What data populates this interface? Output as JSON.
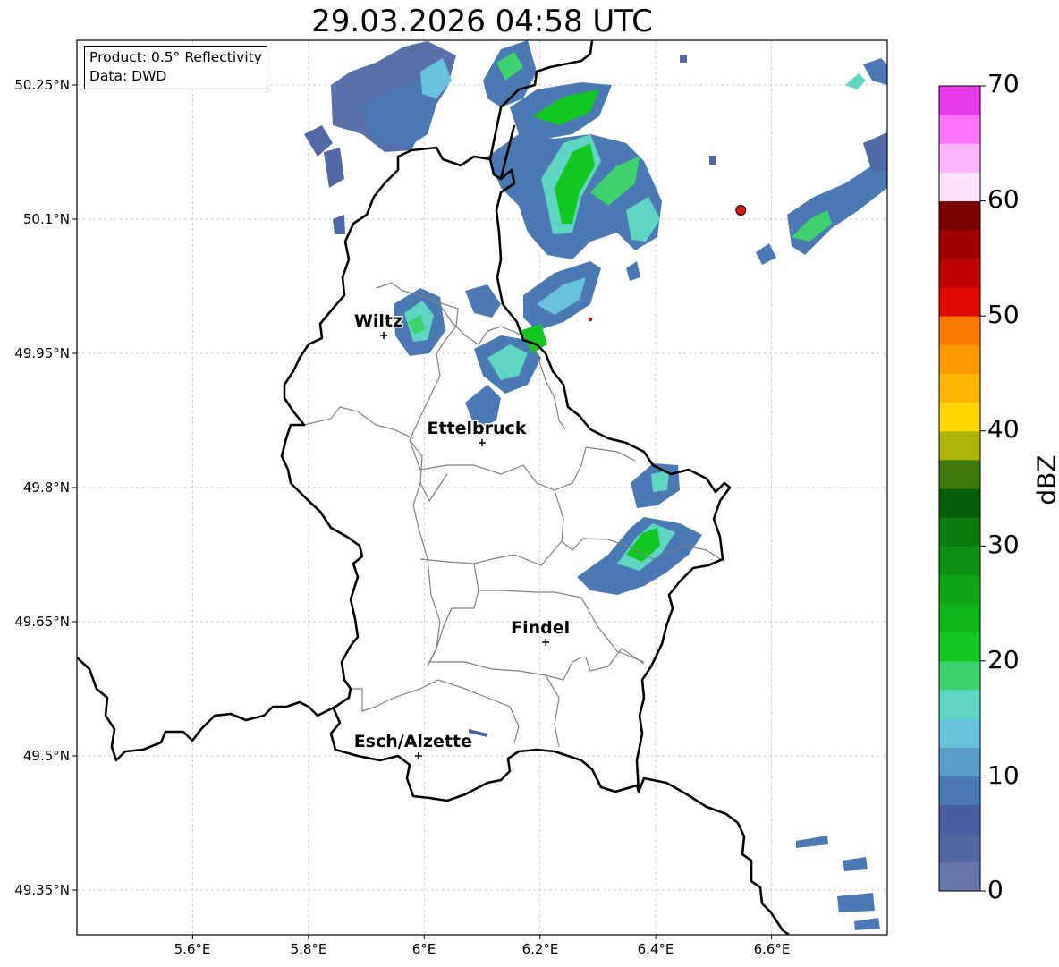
{
  "title": "29.03.2026 04:58 UTC",
  "info": {
    "product_line": "Product: 0.5° Reflectivity",
    "data_line": "Data: DWD"
  },
  "axes": {
    "lat_ticks": [
      "50.25°N",
      "50.1°N",
      "49.95°N",
      "49.8°N",
      "49.65°N",
      "49.5°N",
      "49.35°N"
    ],
    "lon_ticks": [
      "5.6°E",
      "5.8°E",
      "6°E",
      "6.2°E",
      "6.4°E",
      "6.6°E"
    ],
    "lon_range": [
      5.4,
      6.8
    ],
    "lat_range": [
      49.3,
      50.3
    ]
  },
  "cities": [
    {
      "name": "Wiltz",
      "lon": 5.93,
      "lat": 49.97
    },
    {
      "name": "Ettelbruck",
      "lon": 6.1,
      "lat": 49.85
    },
    {
      "name": "Findel",
      "lon": 6.21,
      "lat": 49.627
    },
    {
      "name": "Esch/Alzette",
      "lon": 5.99,
      "lat": 49.5
    }
  ],
  "radar_site": {
    "lon": 6.547,
    "lat": 50.11
  },
  "colorbar": {
    "label": "dBZ",
    "tick_labels": [
      "0",
      "10",
      "20",
      "30",
      "40",
      "50",
      "60",
      "70"
    ],
    "min": 0,
    "max": 70,
    "colors": [
      "#6577aa",
      "#5366a0",
      "#4a5fa3",
      "#4a79b3",
      "#5b9dc9",
      "#67c2dc",
      "#5fd6c4",
      "#3ed26e",
      "#12c820",
      "#10b41a",
      "#0fa315",
      "#0e8e12",
      "#0b7a10",
      "#065e0b",
      "#3f7a0c",
      "#aeb30a",
      "#fed600",
      "#feb700",
      "#fe9800",
      "#fe7a00",
      "#e00a00",
      "#c00000",
      "#a00000",
      "#7a0000",
      "#ffe0ff",
      "#ffb6ff",
      "#ff75ff",
      "#e63be6"
    ]
  },
  "colors": {
    "country_border": "#000000",
    "canton_border": "#808080",
    "grid": "#bfbfbf",
    "radar_site": "#e01010"
  }
}
